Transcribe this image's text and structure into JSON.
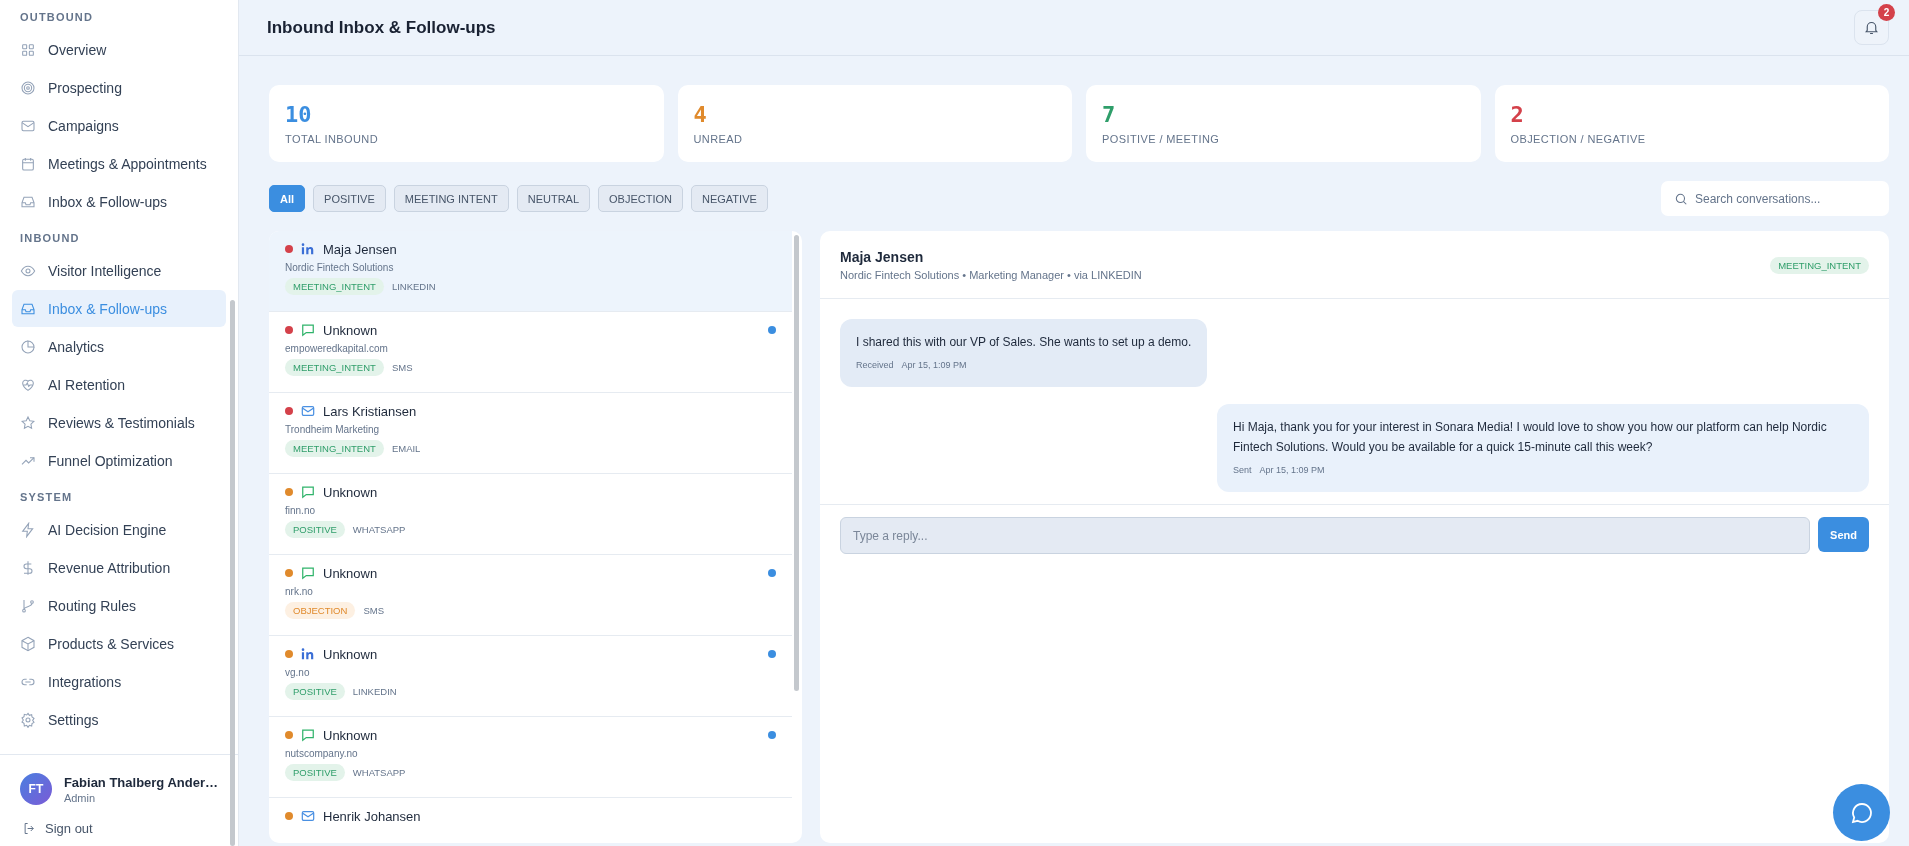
{
  "sidebar": {
    "sections": [
      {
        "title": "OUTBOUND",
        "items": [
          {
            "label": "Overview",
            "kind": "grid",
            "selected": false
          },
          {
            "label": "Prospecting",
            "kind": "target",
            "selected": false
          },
          {
            "label": "Campaigns",
            "kind": "mail",
            "selected": false
          },
          {
            "label": "Meetings & Appointments",
            "kind": "calendar",
            "selected": false
          },
          {
            "label": "Inbox & Follow-ups",
            "kind": "inbox",
            "selected": false
          }
        ]
      },
      {
        "title": "INBOUND",
        "items": [
          {
            "label": "Visitor Intelligence",
            "kind": "eye",
            "selected": false
          },
          {
            "label": "Inbox & Follow-ups",
            "kind": "inbox",
            "selected": true
          },
          {
            "label": "Analytics",
            "kind": "pie",
            "selected": false
          },
          {
            "label": "AI Retention",
            "kind": "heart",
            "selected": false
          },
          {
            "label": "Reviews & Testimonials",
            "kind": "star",
            "selected": false
          },
          {
            "label": "Funnel Optimization",
            "kind": "trend",
            "selected": false
          }
        ]
      },
      {
        "title": "SYSTEM",
        "items": [
          {
            "label": "AI Decision Engine",
            "kind": "bolt",
            "selected": false
          },
          {
            "label": "Revenue Attribution",
            "kind": "dollar",
            "selected": false
          },
          {
            "label": "Routing Rules",
            "kind": "branch",
            "selected": false
          },
          {
            "label": "Products & Services",
            "kind": "box",
            "selected": false
          },
          {
            "label": "Integrations",
            "kind": "link",
            "selected": false
          },
          {
            "label": "Settings",
            "kind": "gear",
            "selected": false
          }
        ]
      }
    ],
    "user": {
      "initials": "FT",
      "name": "Fabian Thalberg Ander…",
      "role": "Admin"
    },
    "sign_out": "Sign out"
  },
  "header": {
    "title": "Inbound Inbox & Follow-ups",
    "notifications": "2"
  },
  "stats": [
    {
      "value": "10",
      "label": "TOTAL INBOUND",
      "color": "#3b8ee0"
    },
    {
      "value": "4",
      "label": "UNREAD",
      "color": "#e08a2c"
    },
    {
      "value": "7",
      "label": "POSITIVE / MEETING",
      "color": "#2f9e6a"
    },
    {
      "value": "2",
      "label": "OBJECTION / NEGATIVE",
      "color": "#d4414a"
    }
  ],
  "filters": [
    {
      "label": "All",
      "selected": true
    },
    {
      "label": "POSITIVE",
      "selected": false
    },
    {
      "label": "MEETING INTENT",
      "selected": false
    },
    {
      "label": "NEUTRAL",
      "selected": false
    },
    {
      "label": "OBJECTION",
      "selected": false
    },
    {
      "label": "NEGATIVE",
      "selected": false
    }
  ],
  "search": {
    "placeholder": "Search conversations..."
  },
  "conversations": [
    {
      "kind": "linkedin",
      "name": "Maja Jensen",
      "subtitle": "Nordic Fintech Solutions",
      "tag": {
        "label": "MEETING_INTENT",
        "kind": "positive"
      },
      "channel": "LINKEDIN",
      "color": "#d4414a",
      "unread": false,
      "selected": true
    },
    {
      "kind": "chat",
      "name": "Unknown",
      "subtitle": "empoweredkapital.com",
      "tag": {
        "label": "MEETING_INTENT",
        "kind": "positive"
      },
      "channel": "SMS",
      "color": "#d4414a",
      "unread": true,
      "selected": false
    },
    {
      "kind": "email",
      "name": "Lars Kristiansen",
      "subtitle": "Trondheim Marketing",
      "tag": {
        "label": "MEETING_INTENT",
        "kind": "positive"
      },
      "channel": "EMAIL",
      "color": "#d4414a",
      "unread": false,
      "selected": false
    },
    {
      "kind": "chat",
      "name": "Unknown",
      "subtitle": "finn.no",
      "tag": {
        "label": "POSITIVE",
        "kind": "positive"
      },
      "channel": "WHATSAPP",
      "color": "#e08a2c",
      "unread": false,
      "selected": false
    },
    {
      "kind": "chat",
      "name": "Unknown",
      "subtitle": "nrk.no",
      "tag": {
        "label": "OBJECTION",
        "kind": "warning"
      },
      "channel": "SMS",
      "color": "#e08a2c",
      "unread": true,
      "selected": false
    },
    {
      "kind": "linkedin",
      "name": "Unknown",
      "subtitle": "vg.no",
      "tag": {
        "label": "POSITIVE",
        "kind": "positive"
      },
      "channel": "LINKEDIN",
      "color": "#e08a2c",
      "unread": true,
      "selected": false
    },
    {
      "kind": "chat",
      "name": "Unknown",
      "subtitle": "nutscompany.no",
      "tag": {
        "label": "POSITIVE",
        "kind": "positive"
      },
      "channel": "WHATSAPP",
      "color": "#e08a2c",
      "unread": true,
      "selected": false
    },
    {
      "kind": "email",
      "name": "Henrik Johansen",
      "color": "#e08a2c",
      "unread": false,
      "selected": false
    }
  ],
  "chat": {
    "name": "Maja Jensen",
    "details": "Nordic Fintech Solutions • Marketing Manager • via LINKEDIN",
    "tag": {
      "label": "MEETING_INTENT",
      "kind": "positive"
    },
    "messages": [
      {
        "kind": "received",
        "text": "I shared this with our VP of Sales. She wants to set up a demo.",
        "status": "Received",
        "time": "Apr 15, 1:09 PM"
      },
      {
        "kind": "sent",
        "text": "Hi Maja, thank you for your interest in Sonara Media! I would love to show you how our platform can help Nordic Fintech Solutions. Would you be available for a quick 15-minute call this week?",
        "status": "Sent",
        "time": "Apr 15, 1:09 PM"
      }
    ],
    "reply_placeholder": "Type a reply...",
    "send": "Send"
  }
}
